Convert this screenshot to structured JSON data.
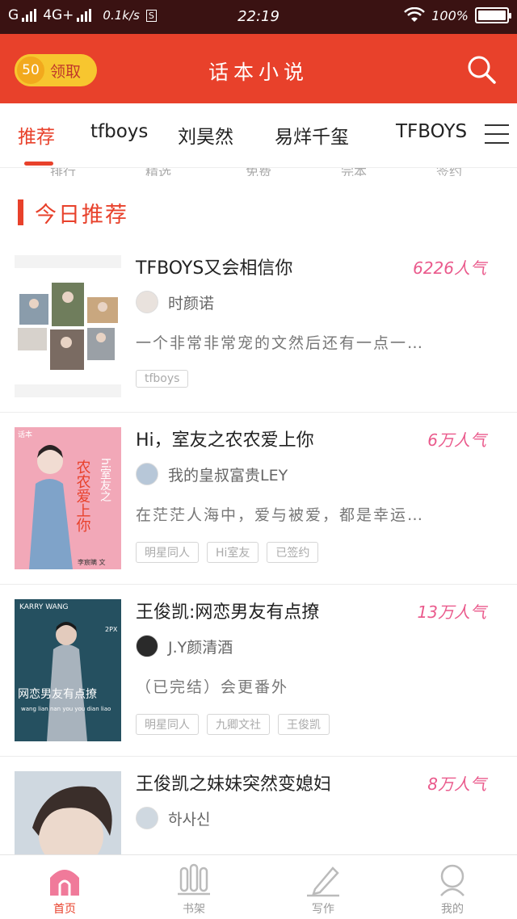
{
  "status_bar": {
    "carrier": "G",
    "network": "4G+",
    "speed": "0.1k/s",
    "sim_badge": "S",
    "time": "22:19",
    "battery": "100%",
    "battery_level": 1.0
  },
  "header": {
    "coin_count": "50",
    "claim_label": "领取",
    "title": "话本小说",
    "icons": {
      "search": "search-icon"
    }
  },
  "tabs": [
    {
      "label": "推荐",
      "active": true
    },
    {
      "label": "tfboys",
      "active": false
    },
    {
      "label": "刘昊然",
      "active": false
    },
    {
      "label": "易烊千玺",
      "active": false
    },
    {
      "label": "TFBOYS",
      "active": false
    }
  ],
  "subnav": [
    "排行",
    "精选",
    "免费",
    "完本",
    "签约"
  ],
  "section": {
    "title": "今日推荐"
  },
  "books": [
    {
      "title": "TFBOYS又会相信你",
      "popularity": "6226人气",
      "author": "时颜诺",
      "description": "一个非常非常宠的文然后还有一点一…",
      "tags": [
        "tfboys"
      ]
    },
    {
      "title": "Hi，室友之农农爱上你",
      "popularity": "6万人气",
      "author": "我的皇叔富贵LEY",
      "description": "在茫茫人海中，爱与被爱，都是幸运…",
      "tags": [
        "明星同人",
        "Hi室友",
        "已签约"
      ],
      "cover_text": {
        "top": "hi室友之",
        "mid": "农农爱上你",
        "author": "李宸瞒 文",
        "badge": "话本"
      }
    },
    {
      "title": "王俊凯:网恋男友有点撩",
      "popularity": "13万人气",
      "author": "J.Y颜清酒",
      "description": "（已完结）会更番外",
      "tags": [
        "明星同人",
        "九卿文社",
        "王俊凯"
      ],
      "cover_text": {
        "top": "KARRY WANG",
        "mid": "网恋男友有点撩",
        "sub": "wang lian nan you you dian liao",
        "corner": "2PX"
      }
    },
    {
      "title": "王俊凯之妹妹突然变媳妇",
      "popularity": "8万人气",
      "author": "하사신",
      "description": "",
      "tags": []
    }
  ],
  "bottom_nav": [
    {
      "label": "首页",
      "icon": "home-icon",
      "active": true
    },
    {
      "label": "书架",
      "icon": "bookshelf-icon",
      "active": false
    },
    {
      "label": "写作",
      "icon": "pen-icon",
      "active": false
    },
    {
      "label": "我的",
      "icon": "profile-icon",
      "active": false
    }
  ],
  "colors": {
    "brand": "#e8412b",
    "popularity": "#ea5a8c",
    "coin": "#f7c62f",
    "status_bar": "#3a1212"
  }
}
